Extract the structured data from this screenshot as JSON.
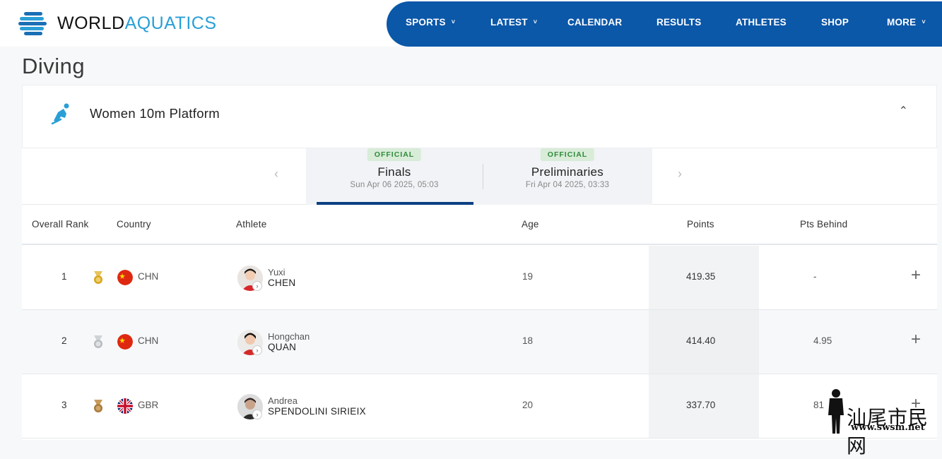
{
  "header": {
    "logo_part1": "WORLD",
    "logo_part2": "AQUATICS",
    "nav": [
      {
        "label": "SPORTS",
        "has_dropdown": true
      },
      {
        "label": "LATEST",
        "has_dropdown": true
      },
      {
        "label": "CALENDAR",
        "has_dropdown": false
      },
      {
        "label": "RESULTS",
        "has_dropdown": false
      },
      {
        "label": "ATHLETES",
        "has_dropdown": false
      },
      {
        "label": "SHOP",
        "has_dropdown": false
      },
      {
        "label": "MORE",
        "has_dropdown": true
      }
    ],
    "chevron": "˅"
  },
  "page": {
    "title": "Diving"
  },
  "event": {
    "name": "Women 10m Platform",
    "icon": "diving-icon",
    "collapse_glyph": "⌃"
  },
  "tabs": [
    {
      "badge": "OFFICIAL",
      "name": "Finals",
      "date": "Sun Apr 06 2025, 05:03",
      "active": true
    },
    {
      "badge": "OFFICIAL",
      "name": "Preliminaries",
      "date": "Fri Apr 04 2025, 03:33",
      "active": false
    }
  ],
  "table": {
    "headers": {
      "rank": "Overall Rank",
      "country": "Country",
      "athlete": "Athlete",
      "age": "Age",
      "points": "Points",
      "behind": "Pts Behind"
    },
    "rows": [
      {
        "rank": "1",
        "medal": "gold",
        "country": "CHN",
        "first": "Yuxi",
        "last": "CHEN",
        "age": "19",
        "points": "419.35",
        "behind": "-"
      },
      {
        "rank": "2",
        "medal": "silver",
        "country": "CHN",
        "first": "Hongchan",
        "last": "QUAN",
        "age": "18",
        "points": "414.40",
        "behind": "4.95"
      },
      {
        "rank": "3",
        "medal": "bronze",
        "country": "GBR",
        "first": "Andrea",
        "last": "SPENDOLINI SIRIEIX",
        "age": "20",
        "points": "337.70",
        "behind": "81"
      }
    ],
    "expand_glyph": "+"
  },
  "colors": {
    "nav_bg": "#0b57a8",
    "logo_accent": "#2a9fd6",
    "badge_bg": "#d8ecd8",
    "badge_text": "#2f8a3a",
    "gold": "#d9a520",
    "silver": "#b9bcc0",
    "bronze": "#a97a3c"
  },
  "watermark": {
    "cn": "汕尾市民网",
    "url": "www.swsm.net"
  }
}
